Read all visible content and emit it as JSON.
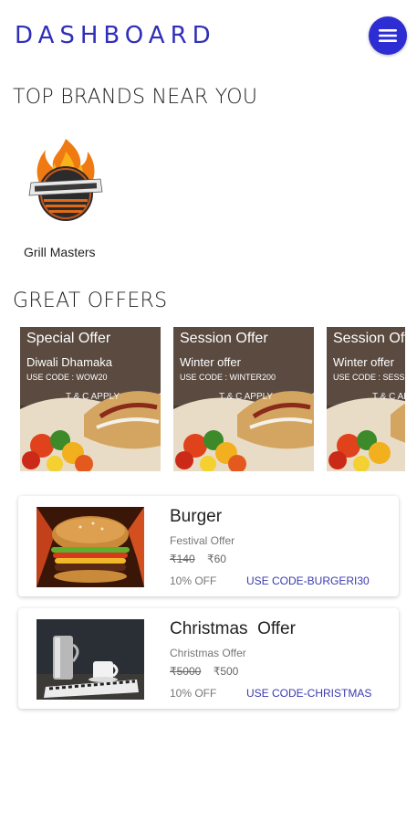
{
  "header": {
    "title": "DASHBOARD",
    "menu_icon": "hamburger-menu-icon",
    "accent_color": "#2d2dd3"
  },
  "top_brands": {
    "heading": "TOP BRANDS NEAR YOU",
    "items": [
      {
        "name": "Grill Masters",
        "logo_icon": "grill-masters-logo"
      }
    ]
  },
  "great_offers": {
    "heading": "GREAT OFFERS",
    "items": [
      {
        "title": "Special Offer",
        "subtitle": "Diwali Dhamaka",
        "code": "USE CODE :  WOW20",
        "terms": "T & C APPLY"
      },
      {
        "title": "Session Offer",
        "subtitle": "Winter offer",
        "code": "USE CODE :  WINTER200",
        "terms": "T & C APPLY"
      },
      {
        "title": "Session Offer",
        "subtitle": "Winter offer",
        "code": "USE CODE :  SESSION",
        "terms": "T & C APPLY"
      }
    ]
  },
  "deals": [
    {
      "title": "Burger",
      "subtitle": "Festival Offer",
      "old_price": "₹140",
      "new_price": "₹60",
      "discount": "10% OFF",
      "code": "USE CODE-BURGERI30"
    },
    {
      "title": "Christmas  Offer",
      "subtitle": "Christmas Offer",
      "old_price": "₹5000",
      "new_price": "₹500",
      "discount": "10% OFF",
      "code": "USE CODE-CHRISTMAS"
    }
  ]
}
